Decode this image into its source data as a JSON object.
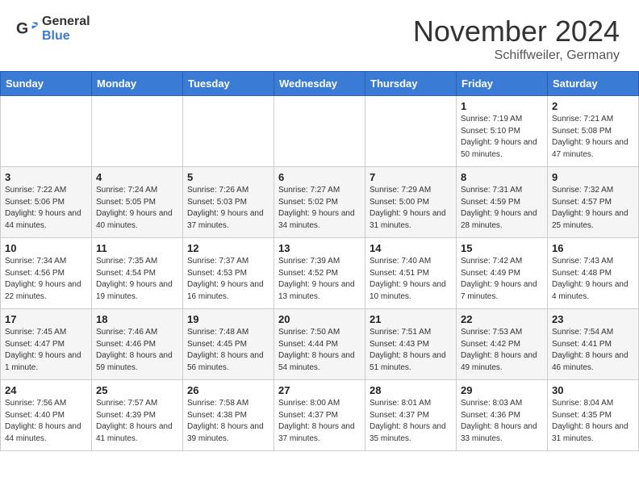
{
  "header": {
    "logo_general": "General",
    "logo_blue": "Blue",
    "month_title": "November 2024",
    "location": "Schiffweiler, Germany"
  },
  "weekdays": [
    "Sunday",
    "Monday",
    "Tuesday",
    "Wednesday",
    "Thursday",
    "Friday",
    "Saturday"
  ],
  "weeks": [
    [
      {
        "day": "",
        "info": ""
      },
      {
        "day": "",
        "info": ""
      },
      {
        "day": "",
        "info": ""
      },
      {
        "day": "",
        "info": ""
      },
      {
        "day": "",
        "info": ""
      },
      {
        "day": "1",
        "info": "Sunrise: 7:19 AM\nSunset: 5:10 PM\nDaylight: 9 hours and 50 minutes."
      },
      {
        "day": "2",
        "info": "Sunrise: 7:21 AM\nSunset: 5:08 PM\nDaylight: 9 hours and 47 minutes."
      }
    ],
    [
      {
        "day": "3",
        "info": "Sunrise: 7:22 AM\nSunset: 5:06 PM\nDaylight: 9 hours and 44 minutes."
      },
      {
        "day": "4",
        "info": "Sunrise: 7:24 AM\nSunset: 5:05 PM\nDaylight: 9 hours and 40 minutes."
      },
      {
        "day": "5",
        "info": "Sunrise: 7:26 AM\nSunset: 5:03 PM\nDaylight: 9 hours and 37 minutes."
      },
      {
        "day": "6",
        "info": "Sunrise: 7:27 AM\nSunset: 5:02 PM\nDaylight: 9 hours and 34 minutes."
      },
      {
        "day": "7",
        "info": "Sunrise: 7:29 AM\nSunset: 5:00 PM\nDaylight: 9 hours and 31 minutes."
      },
      {
        "day": "8",
        "info": "Sunrise: 7:31 AM\nSunset: 4:59 PM\nDaylight: 9 hours and 28 minutes."
      },
      {
        "day": "9",
        "info": "Sunrise: 7:32 AM\nSunset: 4:57 PM\nDaylight: 9 hours and 25 minutes."
      }
    ],
    [
      {
        "day": "10",
        "info": "Sunrise: 7:34 AM\nSunset: 4:56 PM\nDaylight: 9 hours and 22 minutes."
      },
      {
        "day": "11",
        "info": "Sunrise: 7:35 AM\nSunset: 4:54 PM\nDaylight: 9 hours and 19 minutes."
      },
      {
        "day": "12",
        "info": "Sunrise: 7:37 AM\nSunset: 4:53 PM\nDaylight: 9 hours and 16 minutes."
      },
      {
        "day": "13",
        "info": "Sunrise: 7:39 AM\nSunset: 4:52 PM\nDaylight: 9 hours and 13 minutes."
      },
      {
        "day": "14",
        "info": "Sunrise: 7:40 AM\nSunset: 4:51 PM\nDaylight: 9 hours and 10 minutes."
      },
      {
        "day": "15",
        "info": "Sunrise: 7:42 AM\nSunset: 4:49 PM\nDaylight: 9 hours and 7 minutes."
      },
      {
        "day": "16",
        "info": "Sunrise: 7:43 AM\nSunset: 4:48 PM\nDaylight: 9 hours and 4 minutes."
      }
    ],
    [
      {
        "day": "17",
        "info": "Sunrise: 7:45 AM\nSunset: 4:47 PM\nDaylight: 9 hours and 1 minute."
      },
      {
        "day": "18",
        "info": "Sunrise: 7:46 AM\nSunset: 4:46 PM\nDaylight: 8 hours and 59 minutes."
      },
      {
        "day": "19",
        "info": "Sunrise: 7:48 AM\nSunset: 4:45 PM\nDaylight: 8 hours and 56 minutes."
      },
      {
        "day": "20",
        "info": "Sunrise: 7:50 AM\nSunset: 4:44 PM\nDaylight: 8 hours and 54 minutes."
      },
      {
        "day": "21",
        "info": "Sunrise: 7:51 AM\nSunset: 4:43 PM\nDaylight: 8 hours and 51 minutes."
      },
      {
        "day": "22",
        "info": "Sunrise: 7:53 AM\nSunset: 4:42 PM\nDaylight: 8 hours and 49 minutes."
      },
      {
        "day": "23",
        "info": "Sunrise: 7:54 AM\nSunset: 4:41 PM\nDaylight: 8 hours and 46 minutes."
      }
    ],
    [
      {
        "day": "24",
        "info": "Sunrise: 7:56 AM\nSunset: 4:40 PM\nDaylight: 8 hours and 44 minutes."
      },
      {
        "day": "25",
        "info": "Sunrise: 7:57 AM\nSunset: 4:39 PM\nDaylight: 8 hours and 41 minutes."
      },
      {
        "day": "26",
        "info": "Sunrise: 7:58 AM\nSunset: 4:38 PM\nDaylight: 8 hours and 39 minutes."
      },
      {
        "day": "27",
        "info": "Sunrise: 8:00 AM\nSunset: 4:37 PM\nDaylight: 8 hours and 37 minutes."
      },
      {
        "day": "28",
        "info": "Sunrise: 8:01 AM\nSunset: 4:37 PM\nDaylight: 8 hours and 35 minutes."
      },
      {
        "day": "29",
        "info": "Sunrise: 8:03 AM\nSunset: 4:36 PM\nDaylight: 8 hours and 33 minutes."
      },
      {
        "day": "30",
        "info": "Sunrise: 8:04 AM\nSunset: 4:35 PM\nDaylight: 8 hours and 31 minutes."
      }
    ]
  ]
}
